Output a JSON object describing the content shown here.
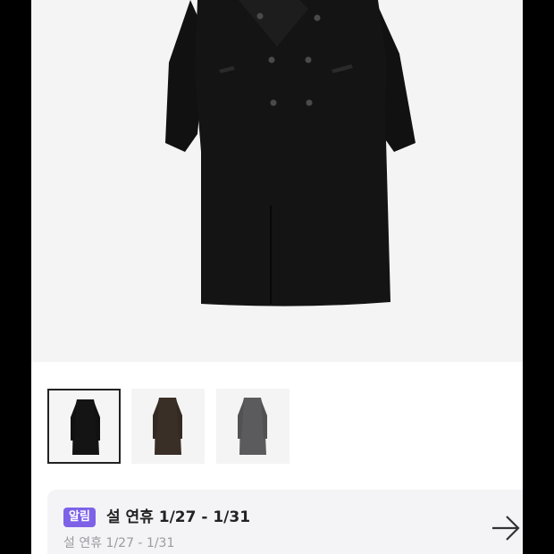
{
  "product": {
    "main_image": {
      "icon": "coat-icon",
      "variant": "black"
    },
    "thumbnails": [
      {
        "variant": "black",
        "color": "#141414",
        "selected": true
      },
      {
        "variant": "brown",
        "color": "#3a2f26",
        "selected": false
      },
      {
        "variant": "charcoal",
        "color": "#5b5b5e",
        "selected": false
      }
    ]
  },
  "notice": {
    "badge": "알림",
    "title": "설 연휴 1/27 - 1/31",
    "subtitle": "설 연휴 1/27 - 1/31",
    "arrow_icon": "arrow-right-icon"
  },
  "colors": {
    "badge": "#7d62e8",
    "notice_bg": "#f4f4f6",
    "coat_black": "#141414"
  }
}
